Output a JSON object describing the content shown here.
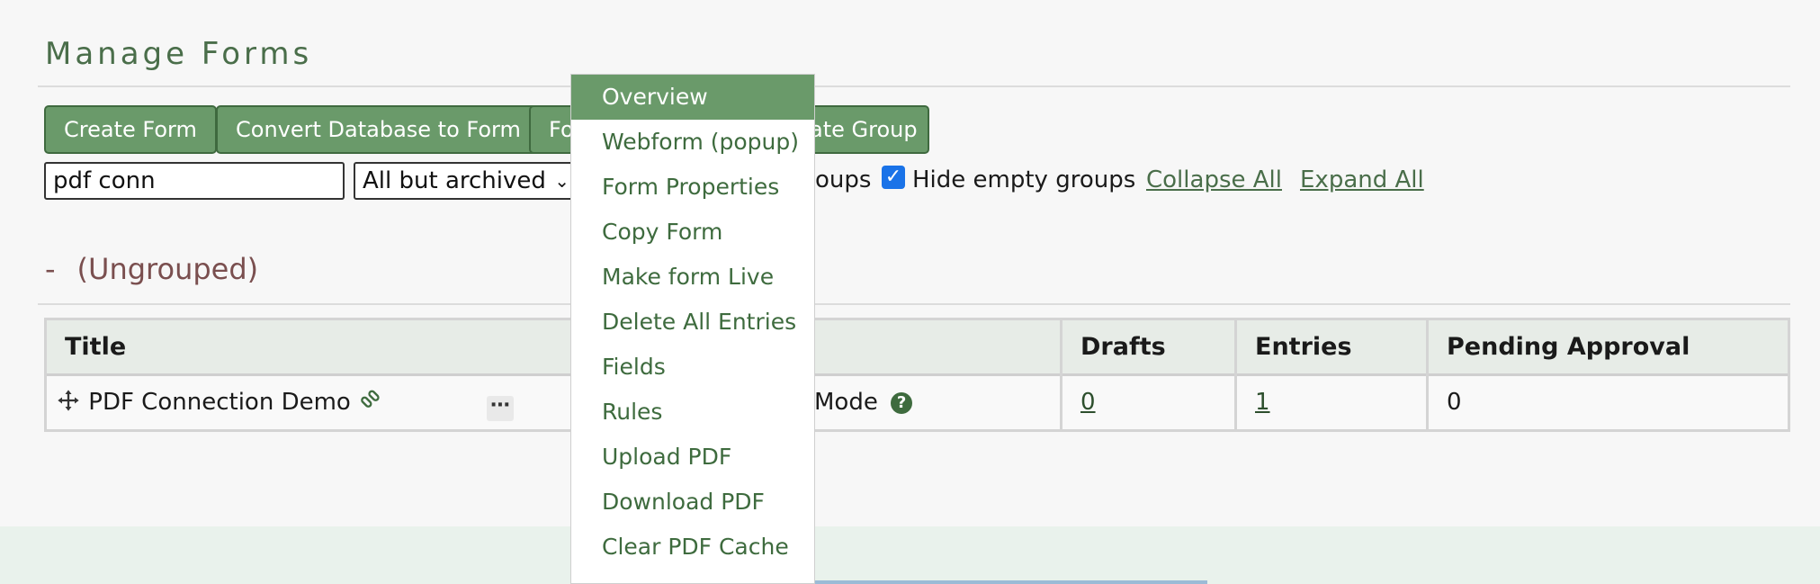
{
  "page": {
    "title": "Manage Forms"
  },
  "toolbar": {
    "create_form": "Create Form",
    "convert_db": "Convert Database to Form",
    "form_partial": "Fo",
    "create_group_partial": "ate Group"
  },
  "filters": {
    "search_value": "pdf conn",
    "status_selected": "All but archived",
    "groups_partial": "oups",
    "hide_empty_label": "Hide empty groups",
    "hide_empty_checked": true,
    "collapse_all": "Collapse All",
    "expand_all": "Expand All"
  },
  "group": {
    "collapse_symbol": "-",
    "name": "(Ungrouped)"
  },
  "table": {
    "columns": [
      "Title",
      "Drafts",
      "Entries",
      "Pending Approval"
    ],
    "rows": [
      {
        "title": "PDF Connection Demo",
        "mode_partial": "Mode",
        "drafts": "0",
        "entries": "1",
        "pending": "0"
      }
    ]
  },
  "dropdown": {
    "items": [
      "Overview",
      "Webform (popup)",
      "Form Properties",
      "Copy Form",
      "Make form Live",
      "Delete All Entries",
      "Fields",
      "Rules",
      "Upload PDF",
      "Download PDF",
      "Clear PDF Cache"
    ],
    "active_index": 0
  },
  "icons": {
    "move": "move-arrows-icon",
    "link": "link-icon",
    "more": "more-dots-icon",
    "help": "help-circle-icon",
    "chevron": "chevron-down-icon",
    "check": "check-icon"
  },
  "colors": {
    "accent": "#6a9a6a",
    "link": "#4a6e4a",
    "group": "#7a4f4f"
  }
}
